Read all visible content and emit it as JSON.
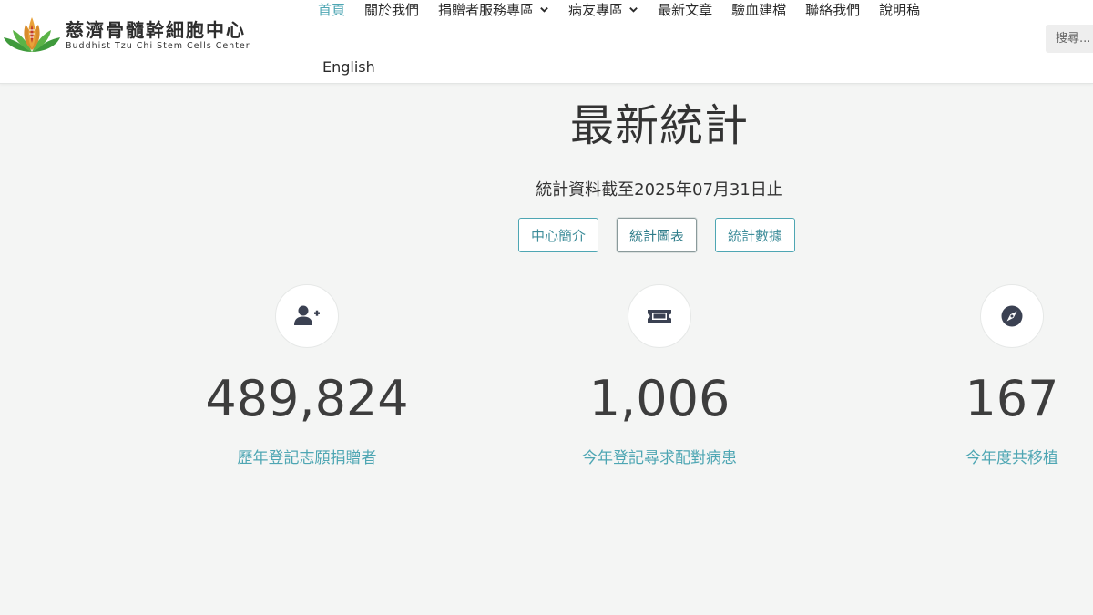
{
  "brand": {
    "name_cn": "慈濟骨髓幹細胞中心",
    "name_en": "Buddhist Tzu Chi Stem Cells Center"
  },
  "nav": {
    "items": [
      {
        "label": "首頁",
        "active": true,
        "dropdown": false
      },
      {
        "label": "關於我們",
        "active": false,
        "dropdown": false
      },
      {
        "label": "捐贈者服務專區",
        "active": false,
        "dropdown": true
      },
      {
        "label": "病友專區",
        "active": false,
        "dropdown": true
      },
      {
        "label": "最新文章",
        "active": false,
        "dropdown": false
      },
      {
        "label": "驗血建檔",
        "active": false,
        "dropdown": false
      },
      {
        "label": "聯絡我們",
        "active": false,
        "dropdown": false
      },
      {
        "label": "說明稿",
        "active": false,
        "dropdown": false
      }
    ],
    "english": "English"
  },
  "search": {
    "placeholder": "搜尋..."
  },
  "main": {
    "title": "最新統計",
    "subtitle": "統計資料截至2025年07月31日止",
    "buttons": [
      {
        "label": "中心簡介"
      },
      {
        "label": "統計圖表",
        "selected": true
      },
      {
        "label": "統計數據"
      }
    ]
  },
  "stats": [
    {
      "icon": "user-plus-icon",
      "value": "489,824",
      "label": "歷年登記志願捐贈者"
    },
    {
      "icon": "ticket-icon",
      "value": "1,006",
      "label": "今年登記尋求配對病患"
    },
    {
      "icon": "compass-icon",
      "value": "167",
      "label": "今年度共移植"
    }
  ],
  "colors": {
    "accent": "#4ea6b3",
    "icon_dark": "#3b4152",
    "background": "#f4f5f4"
  }
}
